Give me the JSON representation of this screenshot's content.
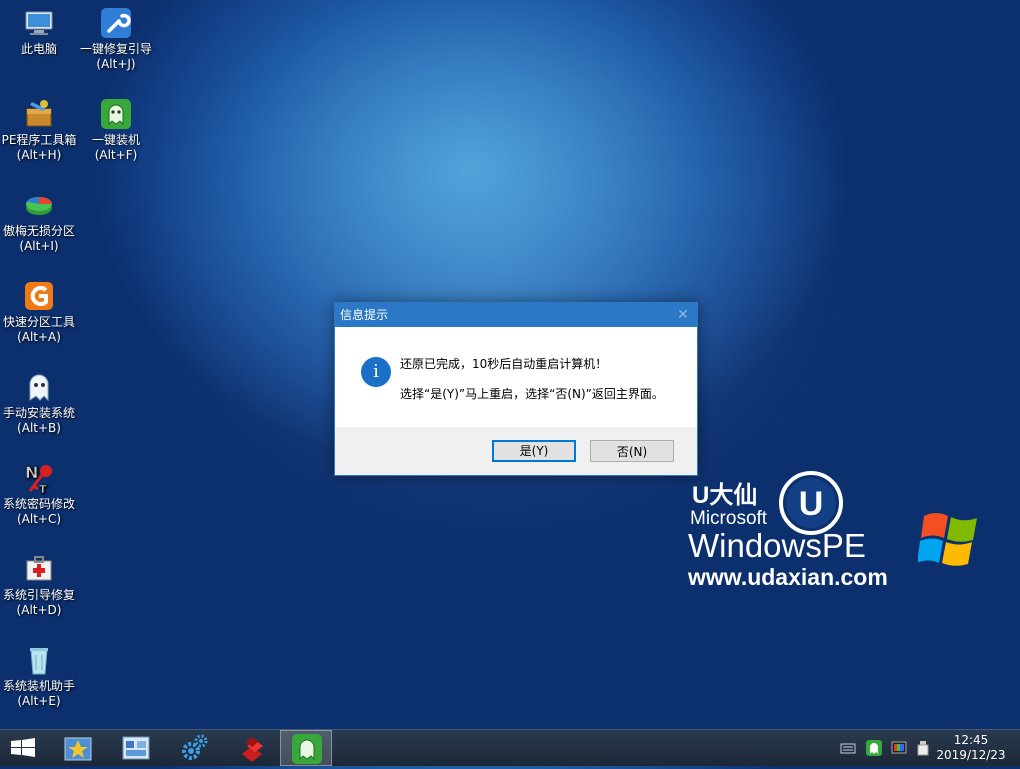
{
  "desktop": {
    "icons": [
      {
        "label": "此电脑",
        "shortcut": ""
      },
      {
        "label": "一键修复引导",
        "shortcut": "(Alt+J)"
      },
      {
        "label": "PE程序工具箱",
        "shortcut": "(Alt+H)"
      },
      {
        "label": "一键装机",
        "shortcut": "(Alt+F)"
      },
      {
        "label": "傲梅无损分区",
        "shortcut": "(Alt+I)"
      },
      {
        "label": "快速分区工具",
        "shortcut": "(Alt+A)"
      },
      {
        "label": "手动安装系统",
        "shortcut": "(Alt+B)"
      },
      {
        "label": "系统密码修改",
        "shortcut": "(Alt+C)"
      },
      {
        "label": "系统引导修复",
        "shortcut": "(Alt+D)"
      },
      {
        "label": "系统装机助手",
        "shortcut": "(Alt+E)"
      }
    ]
  },
  "dialog": {
    "title": "信息提示",
    "close_glyph": "✕",
    "info_glyph": "i",
    "message_line1": "还原已完成，10秒后自动重启计算机！",
    "message_line2": "选择“是(Y)”马上重启，选择“否(N)”返回主界面。",
    "yes_label": "是(Y)",
    "no_label": "否(N)"
  },
  "branding": {
    "name": "U大仙",
    "microsoft": "Microsoft",
    "windows_pe": "WindowsPE",
    "url": "www.udaxian.com",
    "logo_letter": "U"
  },
  "taskbar": {
    "clock_time": "12:45",
    "clock_date": "2019/12/23",
    "apps": [
      "desktop-tools",
      "registry-tool",
      "settings",
      "blocks-tool",
      "one-key-install"
    ]
  },
  "colors": {
    "dialog_title_bar": "#2b78c6",
    "taskbar": "#1f2d3f",
    "desktop_accent": "#1d5aa6"
  }
}
